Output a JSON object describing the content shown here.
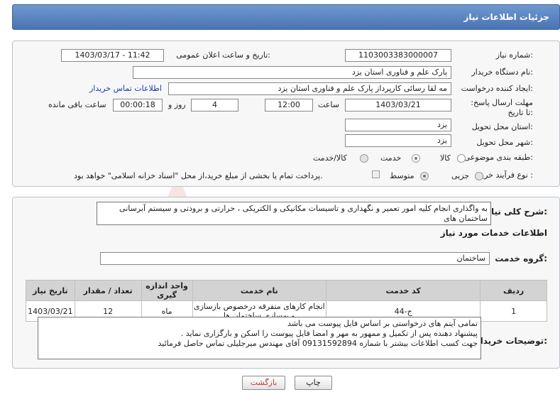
{
  "header": {
    "title": "جزئیات اطلاعات نیاز"
  },
  "form": {
    "need_number_label": "شماره نیاز:",
    "need_number": "1103003383000007",
    "announce_label": "تاریخ و ساعت اعلان عمومی:",
    "announce_value": "1403/03/17 - 11:42",
    "buyer_org_label": "نام دستگاه خریدار:",
    "buyer_org": "پارک علم و فناوری استان یزد",
    "creator_label": "ایجاد کننده درخواست:",
    "creator": "مه لقا رسائی  کارپرداز پارک علم و فناوری استان یزد",
    "contact_link": "اطلاعات تماس خریدار",
    "deadline_label": "مهلت ارسال پاسخ: تا تاریخ:",
    "deadline_date": "1403/03/21",
    "time_label": "ساعت",
    "deadline_time": "12:00",
    "days_value": "4",
    "days_label": "روز و",
    "remaining_time": "00:00:18",
    "remaining_label": "ساعت باقی مانده",
    "province_label": "استان محل تحویل:",
    "province": "یزد",
    "city_label": "شهر محل تحویل:",
    "city": "یزد",
    "category_label": "طبقه بندی موضوعی:",
    "category_options": [
      "کالا",
      "خدمت",
      "کالا/خدمت"
    ],
    "process_label": "نوع فرآیند خرید :",
    "process_options": [
      "جزیی",
      "متوسط"
    ],
    "payment_note": "پرداخت تمام یا بخشی از مبلغ خرید،از محل \"اسناد خزانه اسلامی\" خواهد بود."
  },
  "description": {
    "label": "شرح کلی نیاز:",
    "text": "به واگذاری انجام کلیه امور تعمیر و نگهداری و تاسیسات مکانیکی و الکتریکی ، حرارتی و برودتی و سیستم آبرسانی ساختمان های"
  },
  "services": {
    "section_title": "اطلاعات خدمات مورد نیاز",
    "group_label": "گروه خدمت:",
    "group_value": "ساختمان",
    "columns": [
      "ردیف",
      "کد خدمت",
      "نام خدمت",
      "واحد اندازه گیری",
      "تعداد / مقدار",
      "تاریخ نیاز"
    ],
    "rows": [
      [
        "1",
        "ج-44",
        "انجام کارهای متفرقه درخصوص بازسازی و بهسازی ساختمان ها",
        "ماه",
        "12",
        "1403/03/21"
      ]
    ]
  },
  "buyer_notes": {
    "label": "توضیحات خریدار:",
    "lines": [
      "تمامی آیتم های درخواستی بر اساس فایل پیوست می باشد",
      "پیشنهاد دهنده پس از تکمیل و ممهور به مهر و امضا فایل پیوست را اسکن و بارگزاری نماید .",
      "جهت کسب اطلاعات بیشتر با شماره  09131592894 آقای مهندس میرجلیلی تماس حاصل فرمائید"
    ]
  },
  "buttons": {
    "print": "چاپ",
    "back": "بازگشت"
  },
  "watermark_text": "AriaTender.net",
  "colors": {
    "header": "#5a82bf",
    "link": "#1a3ea8",
    "back_text": "#c0392b",
    "watermark": "#c0392b"
  }
}
